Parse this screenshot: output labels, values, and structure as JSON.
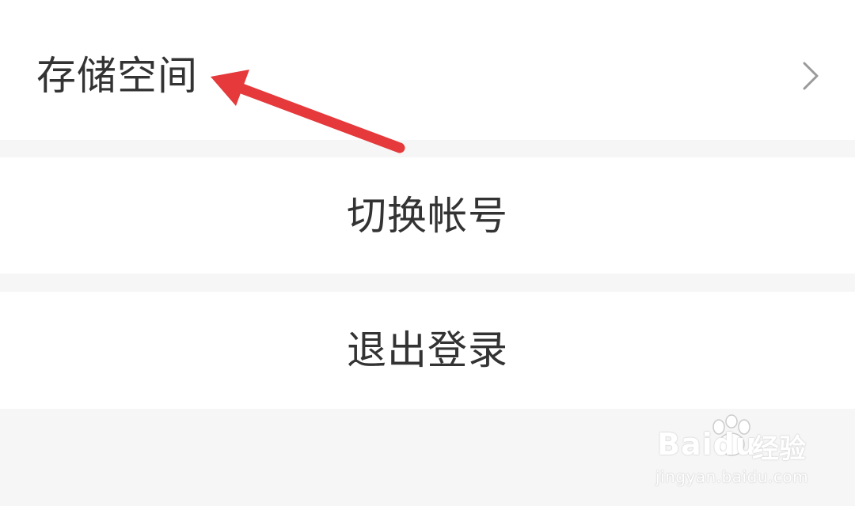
{
  "menu": {
    "storage_label": "存储空间",
    "switch_account_label": "切换帐号",
    "logout_label": "退出登录"
  },
  "icons": {
    "chevron": "chevron-right-icon",
    "annotation": "red-arrow-annotation"
  },
  "colors": {
    "background": "#f6f6f6",
    "row": "#ffffff",
    "text": "#333333",
    "chevron": "#999999",
    "annotation_arrow": "#e5393b"
  },
  "watermark": {
    "brand_left": "Bai",
    "brand_mid": "du",
    "brand_right": "经验",
    "url": "jingyan.baidu.com"
  }
}
